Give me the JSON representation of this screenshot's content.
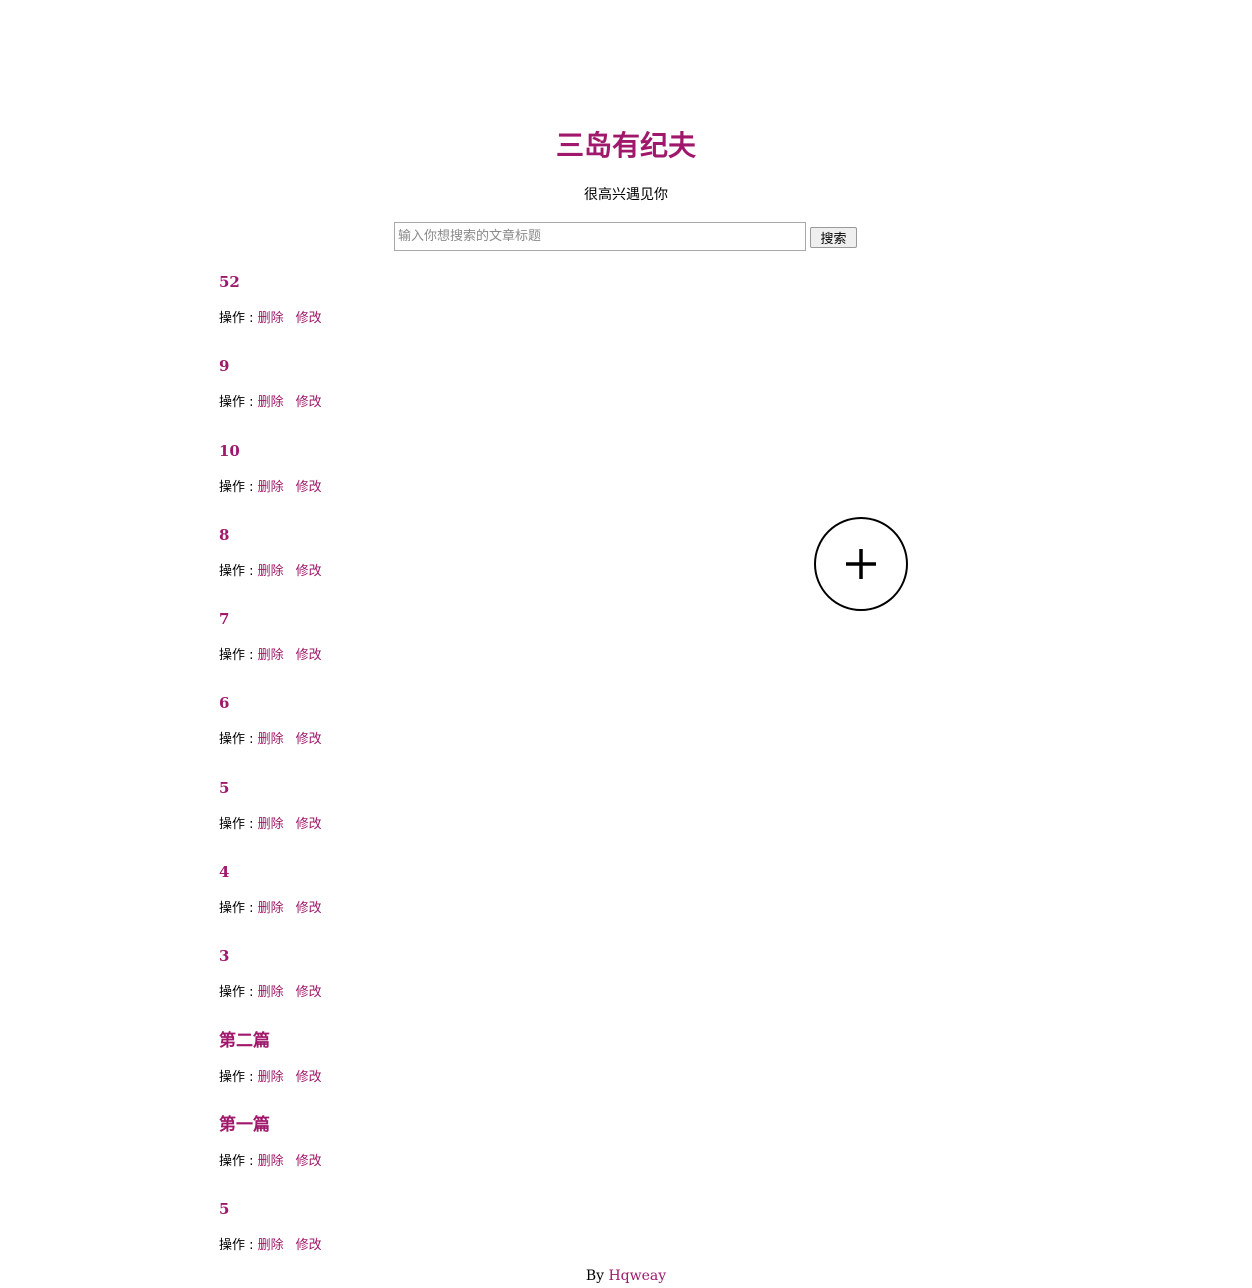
{
  "header": {
    "title": "三岛有纪夫",
    "subtitle": "很高兴遇见你"
  },
  "search": {
    "placeholder": "输入你想搜索的文章标题",
    "value": "",
    "button_label": "搜索"
  },
  "posts": [
    {
      "title": "52",
      "actions_label": "操作 : ",
      "delete_label": "删除",
      "edit_label": "修改"
    },
    {
      "title": "9",
      "actions_label": "操作 : ",
      "delete_label": "删除",
      "edit_label": "修改"
    },
    {
      "title": "10",
      "actions_label": "操作 : ",
      "delete_label": "删除",
      "edit_label": "修改"
    },
    {
      "title": "8",
      "actions_label": "操作 : ",
      "delete_label": "删除",
      "edit_label": "修改"
    },
    {
      "title": "7",
      "actions_label": "操作 : ",
      "delete_label": "删除",
      "edit_label": "修改"
    },
    {
      "title": "6",
      "actions_label": "操作 : ",
      "delete_label": "删除",
      "edit_label": "修改"
    },
    {
      "title": "5",
      "actions_label": "操作 : ",
      "delete_label": "删除",
      "edit_label": "修改"
    },
    {
      "title": "4",
      "actions_label": "操作 : ",
      "delete_label": "删除",
      "edit_label": "修改"
    },
    {
      "title": "3",
      "actions_label": "操作 : ",
      "delete_label": "删除",
      "edit_label": "修改"
    },
    {
      "title": "第二篇",
      "actions_label": "操作 : ",
      "delete_label": "删除",
      "edit_label": "修改"
    },
    {
      "title": "第一篇",
      "actions_label": "操作 : ",
      "delete_label": "删除",
      "edit_label": "修改"
    },
    {
      "title": "5",
      "actions_label": "操作 : ",
      "delete_label": "删除",
      "edit_label": "修改"
    }
  ],
  "add_button": {
    "icon": "plus-icon"
  },
  "footer": {
    "prefix": "By ",
    "author": "Hqweay"
  },
  "colors": {
    "accent": "#a0186b",
    "text": "#000000",
    "background": "#ffffff"
  }
}
